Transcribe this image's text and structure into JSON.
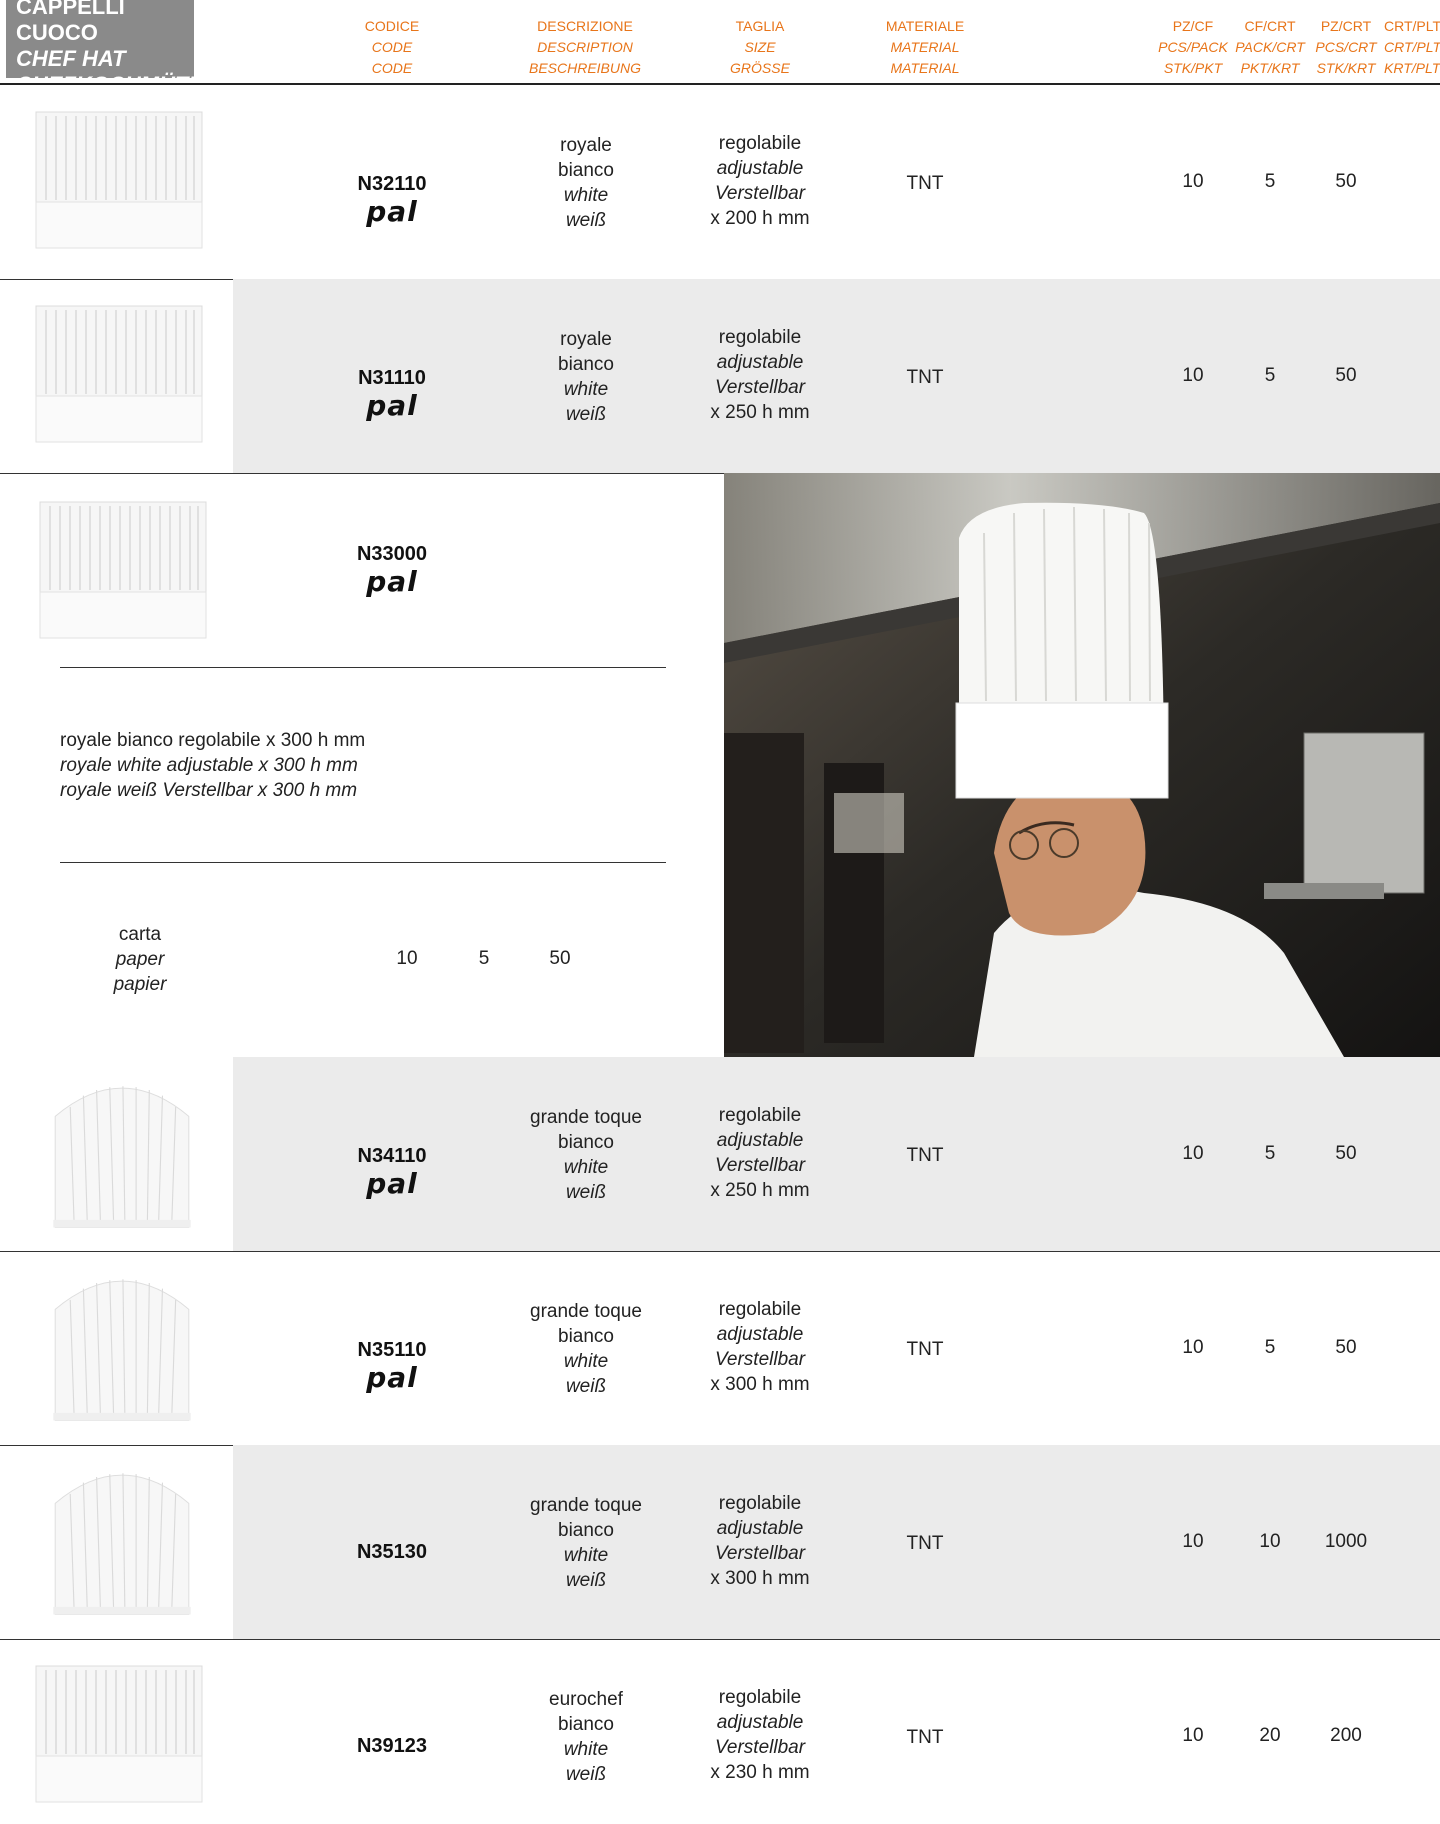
{
  "title": {
    "it": "CAPPELLI CUOCO",
    "en": "CHEF HAT",
    "de": "CHEFKOCHMÜTZE"
  },
  "headers": [
    {
      "key": "code",
      "lines": [
        "CODICE",
        "CODE",
        "CODE"
      ]
    },
    {
      "key": "desc",
      "lines": [
        "DESCRIZIONE",
        "DESCRIPTION",
        "BESCHREIBUNG"
      ]
    },
    {
      "key": "size",
      "lines": [
        "TAGLIA",
        "SIZE",
        "GRÖSSE"
      ]
    },
    {
      "key": "material",
      "lines": [
        "MATERIALE",
        "MATERIAL",
        "MATERIAL"
      ]
    },
    {
      "key": "pzcf",
      "lines": [
        "PZ/CF",
        "PCS/PACK",
        "STK/PKT"
      ]
    },
    {
      "key": "cfcrt",
      "lines": [
        "CF/CRT",
        "PACK/CRT",
        "PKT/KRT"
      ]
    },
    {
      "key": "pzcrt",
      "lines": [
        "PZ/CRT",
        "PCS/CRT",
        "STK/KRT"
      ]
    },
    {
      "key": "crtplt",
      "lines": [
        "CRT/PLT",
        "CRT/PLT",
        "KRT/PLT"
      ]
    }
  ],
  "brand_logo": "pal",
  "rows": [
    {
      "code": "N32110",
      "pal": true,
      "desc": [
        "royale",
        "bianco",
        "white",
        "weiß"
      ],
      "size": [
        "regolabile",
        "adjustable",
        "Verstellbar",
        "x 200 h mm"
      ],
      "material": "TNT",
      "pzcf": "10",
      "cfcrt": "5",
      "pzcrt": "50",
      "hat": "royale"
    },
    {
      "code": "N31110",
      "pal": true,
      "desc": [
        "royale",
        "bianco",
        "white",
        "weiß"
      ],
      "size": [
        "regolabile",
        "adjustable",
        "Verstellbar",
        "x 250 h mm"
      ],
      "material": "TNT",
      "pzcf": "10",
      "cfcrt": "5",
      "pzcrt": "50",
      "hat": "royale"
    },
    {
      "code": "N34110",
      "pal": true,
      "desc": [
        "grande toque",
        "bianco",
        "white",
        "weiß"
      ],
      "size": [
        "regolabile",
        "adjustable",
        "Verstellbar",
        "x 250 h mm"
      ],
      "material": "TNT",
      "pzcf": "10",
      "cfcrt": "5",
      "pzcrt": "50",
      "hat": "toque"
    },
    {
      "code": "N35110",
      "pal": true,
      "desc": [
        "grande toque",
        "bianco",
        "white",
        "weiß"
      ],
      "size": [
        "regolabile",
        "adjustable",
        "Verstellbar",
        "x 300 h mm"
      ],
      "material": "TNT",
      "pzcf": "10",
      "cfcrt": "5",
      "pzcrt": "50",
      "hat": "toque"
    },
    {
      "code": "N35130",
      "pal": false,
      "desc": [
        "grande toque",
        "bianco",
        "white",
        "weiß"
      ],
      "size": [
        "regolabile",
        "adjustable",
        "Verstellbar",
        "x 300 h mm"
      ],
      "material": "TNT",
      "pzcf": "10",
      "cfcrt": "10",
      "pzcrt": "1000",
      "hat": "toque"
    },
    {
      "code": "N39123",
      "pal": false,
      "desc": [
        "eurochef",
        "bianco",
        "white",
        "weiß"
      ],
      "size": [
        "regolabile",
        "adjustable",
        "Verstellbar",
        "x 230 h mm"
      ],
      "material": "TNT",
      "pzcf": "10",
      "cfcrt": "20",
      "pzcrt": "200",
      "hat": "royale"
    }
  ],
  "featured": {
    "code": "N33000",
    "pal": true,
    "desc_lines": [
      "royale bianco regolabile x 300 h mm",
      "royale white adjustable x 300 h mm",
      "royale weiß Verstellbar x 300 h mm"
    ],
    "material": [
      "carta",
      "paper",
      "papier"
    ],
    "pzcf": "10",
    "cfcrt": "5",
    "pzcrt": "50",
    "photo": "chef-wearing-tall-paper-hat-photo"
  },
  "colors": {
    "header_orange": "#e8751a",
    "title_grey": "#8a8a8a",
    "row_shade": "#ebebeb"
  }
}
